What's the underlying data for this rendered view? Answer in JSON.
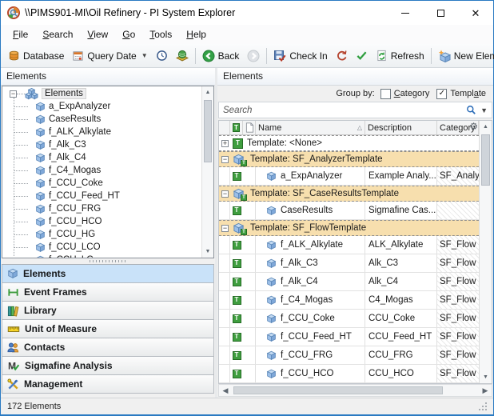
{
  "window": {
    "title": "\\\\PIMS901-MI\\Oil Refinery - PI System Explorer"
  },
  "menu_bar": {
    "items": [
      {
        "label": "File",
        "accel": 0
      },
      {
        "label": "Search",
        "accel": 0
      },
      {
        "label": "View",
        "accel": 0
      },
      {
        "label": "Go",
        "accel": 0
      },
      {
        "label": "Tools",
        "accel": 0
      },
      {
        "label": "Help",
        "accel": 0
      }
    ]
  },
  "toolbar": {
    "database": "Database",
    "query_date": "Query Date",
    "back": "Back",
    "check_in": "Check In",
    "refresh": "Refresh",
    "new_element": "New Element"
  },
  "left_panel": {
    "header": "Elements",
    "tree": {
      "root": "Elements",
      "children": [
        "a_ExpAnalyzer",
        "CaseResults",
        "f_ALK_Alkylate",
        "f_Alk_C3",
        "f_Alk_C4",
        "f_C4_Mogas",
        "f_CCU_Coke",
        "f_CCU_Feed_HT",
        "f_CCU_FRG",
        "f_CCU_HCO",
        "f_CCU_HG",
        "f_CCU_LCO",
        "f_CCU_LG"
      ]
    },
    "nav_items": [
      {
        "label": "Elements",
        "icon": "cube-icon",
        "selected": true
      },
      {
        "label": "Event Frames",
        "icon": "event-frames-icon",
        "selected": false
      },
      {
        "label": "Library",
        "icon": "library-icon",
        "selected": false
      },
      {
        "label": "Unit of Measure",
        "icon": "unit-of-measure-icon",
        "selected": false
      },
      {
        "label": "Contacts",
        "icon": "contacts-icon",
        "selected": false
      },
      {
        "label": "Sigmafine Analysis",
        "icon": "sigmafine-analysis-icon",
        "selected": false
      },
      {
        "label": "Management",
        "icon": "management-icon",
        "selected": false
      }
    ]
  },
  "right_panel": {
    "header": "Elements",
    "group_by": {
      "label": "Group by:",
      "options": [
        {
          "label": "Category",
          "accel": 0,
          "checked": false
        },
        {
          "label": "Template",
          "accel": 5,
          "checked": true
        }
      ]
    },
    "search": {
      "placeholder": "Search"
    },
    "table": {
      "columns": [
        {
          "label": "Name",
          "sort": "asc"
        },
        {
          "label": "Description"
        },
        {
          "label": "Category"
        }
      ],
      "rows": [
        {
          "type": "group",
          "label": "Template: <None>",
          "expanded": false,
          "none": true
        },
        {
          "type": "group",
          "label": "Template: SF_AnalyzerTemplate",
          "expanded": true,
          "none": false
        },
        {
          "type": "item",
          "name": "a_ExpAnalyzer",
          "description": "Example Analy...",
          "category": "SF_Analy"
        },
        {
          "type": "group",
          "label": "Template: SF_CaseResultsTemplate",
          "expanded": true,
          "none": false
        },
        {
          "type": "item",
          "name": "CaseResults",
          "description": "Sigmafine Cas...",
          "category": ""
        },
        {
          "type": "group",
          "label": "Template: SF_FlowTemplate",
          "expanded": true,
          "none": false
        },
        {
          "type": "item",
          "name": "f_ALK_Alkylate",
          "description": "ALK_Alkylate",
          "category": "SF_Flow"
        },
        {
          "type": "item",
          "name": "f_Alk_C3",
          "description": "Alk_C3",
          "category": "SF_Flow"
        },
        {
          "type": "item",
          "name": "f_Alk_C4",
          "description": "Alk_C4",
          "category": "SF_Flow"
        },
        {
          "type": "item",
          "name": "f_C4_Mogas",
          "description": "C4_Mogas",
          "category": "SF_Flow"
        },
        {
          "type": "item",
          "name": "f_CCU_Coke",
          "description": "CCU_Coke",
          "category": "SF_Flow"
        },
        {
          "type": "item",
          "name": "f_CCU_Feed_HT",
          "description": "CCU_Feed_HT",
          "category": "SF_Flow"
        },
        {
          "type": "item",
          "name": "f_CCU_FRG",
          "description": "CCU_FRG",
          "category": "SF_Flow"
        },
        {
          "type": "item",
          "name": "f_CCU_HCO",
          "description": "CCU_HCO",
          "category": "SF_Flow"
        }
      ]
    }
  },
  "status_bar": {
    "text": "172 Elements"
  }
}
